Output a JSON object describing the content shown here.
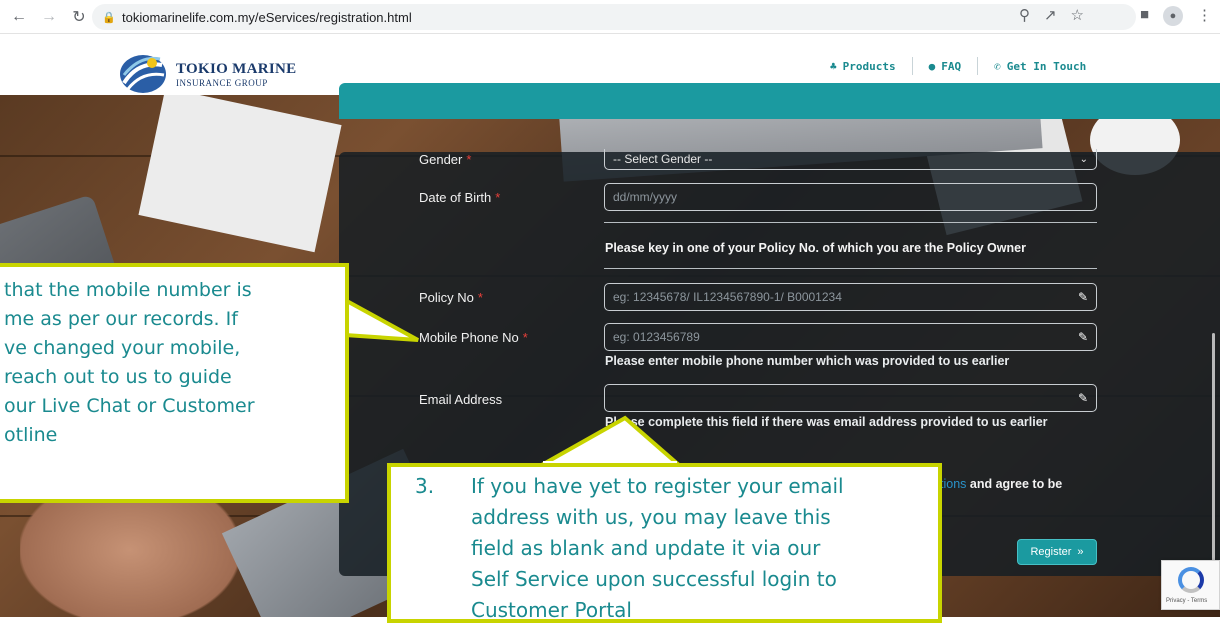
{
  "browser": {
    "url": "tokiomarinelife.com.my/eServices/registration.html"
  },
  "logo": {
    "line1": "TOKIO MARINE",
    "line2": "INSURANCE GROUP"
  },
  "topnav": {
    "products": "Products",
    "faq": "FAQ",
    "contact": "Get In Touch"
  },
  "form": {
    "gender": {
      "label": "Gender",
      "value": "-- Select Gender --"
    },
    "dob": {
      "label": "Date of Birth",
      "placeholder": "dd/mm/yyyy"
    },
    "policy_notice": "Please key in one of your Policy No. of which you are the Policy Owner",
    "policy": {
      "label": "Policy No",
      "placeholder": "eg: 12345678/ IL1234567890-1/ B0001234"
    },
    "mobile": {
      "label": "Mobile Phone No",
      "placeholder": "eg: 0123456789",
      "hint": "Please enter mobile phone number which was provided to us earlier"
    },
    "email": {
      "label": "Email Address",
      "placeholder": "",
      "hint": "Please complete this field if there was email address provided to us earlier"
    },
    "terms_link": "tions",
    "terms_rest": " and agree to be",
    "register": "Register"
  },
  "callouts": {
    "left": [
      " that the mobile number is",
      "me as per our records. If",
      "ve changed your mobile,",
      " reach out to us to guide",
      "our Live Chat or Customer",
      "otline"
    ],
    "bottom_number": "3.",
    "bottom_lines": [
      "If you have yet to register your email",
      "address with us, you may leave this",
      "field as blank and update it via our",
      "Self Service upon successful login to",
      "Customer Portal"
    ]
  },
  "recaptcha": {
    "text": "Privacy - Terms"
  },
  "colors": {
    "teal": "#1b9aa0",
    "callout_border": "#c8d400",
    "callout_text": "#1a8a8f",
    "required": "#e8403a"
  }
}
